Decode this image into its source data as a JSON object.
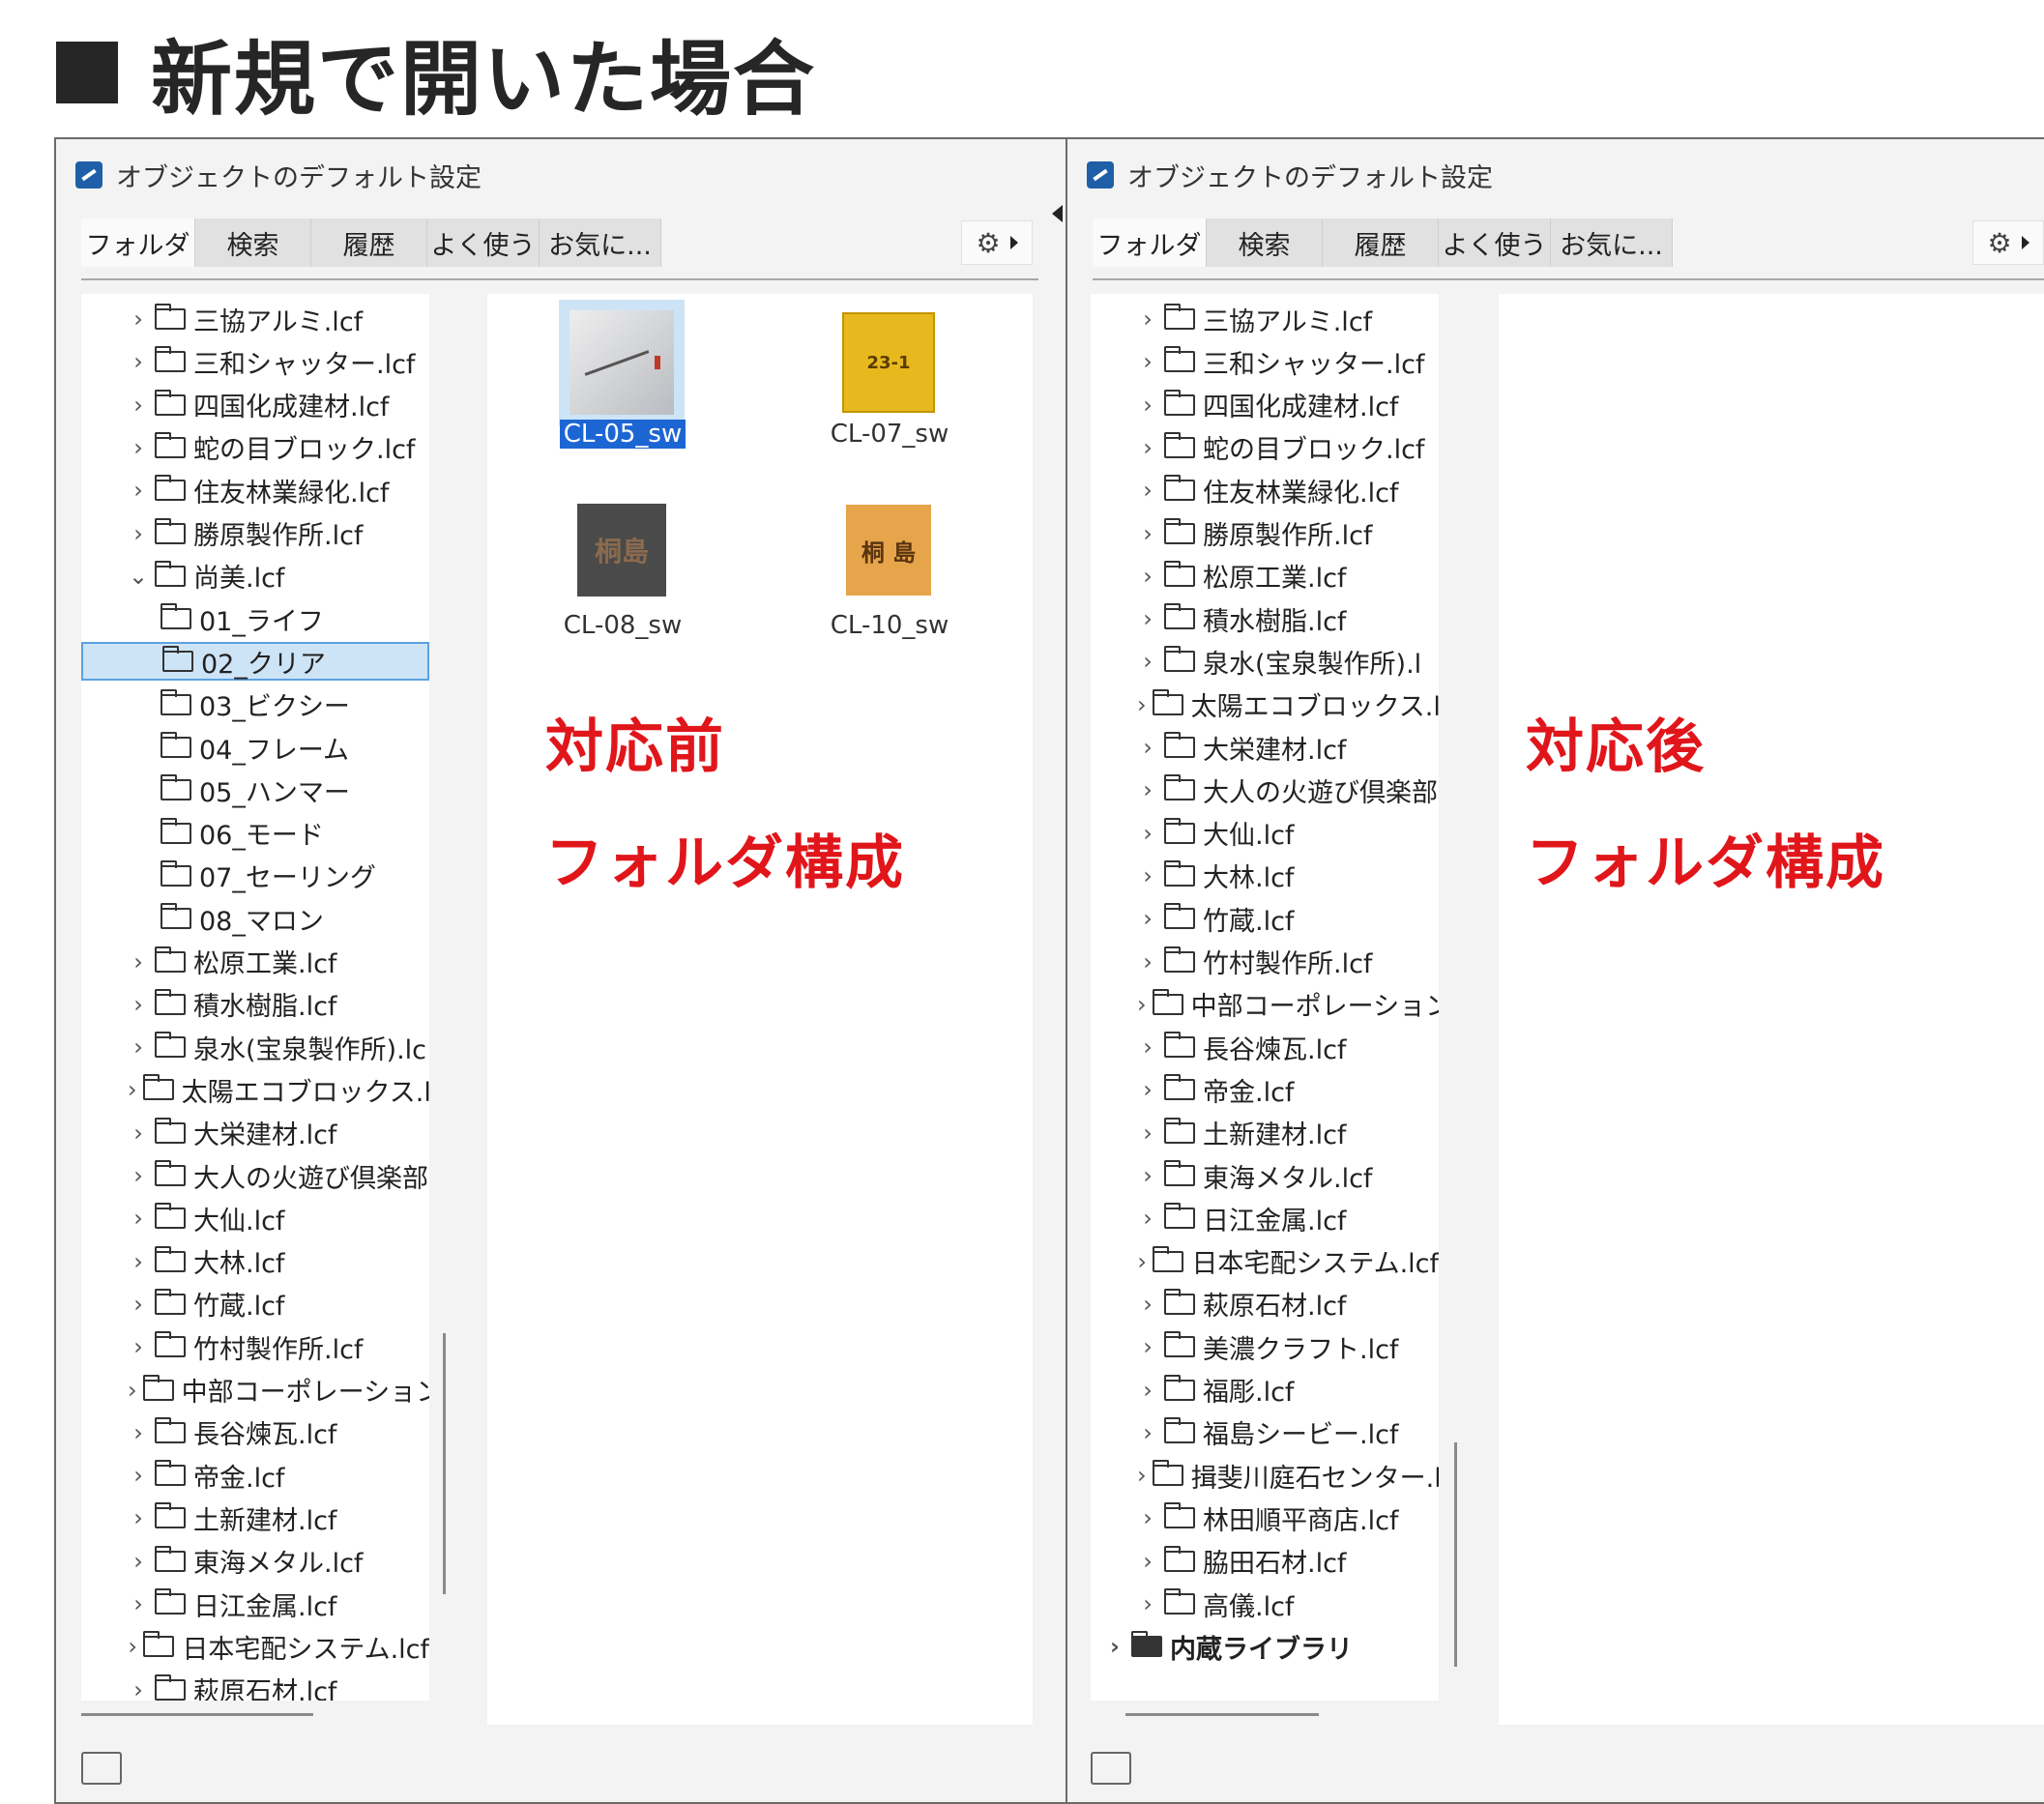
{
  "heading": "新規で開いた場合",
  "colors": {
    "accent_red": "#e0161b",
    "selection_blue": "#1c66d4",
    "selection_bg": "#cde4f7"
  },
  "left": {
    "title": "オブジェクトのデフォルト設定",
    "tabs": [
      "フォルダ",
      "検索",
      "履歴",
      "よく使う",
      "お気に..."
    ],
    "tree": [
      {
        "label": "三協アルミ.lcf",
        "expander": "›"
      },
      {
        "label": "三和シャッター.lcf",
        "expander": "›"
      },
      {
        "label": "四国化成建材.lcf",
        "expander": "›"
      },
      {
        "label": "蛇の目ブロック.lcf",
        "expander": "›"
      },
      {
        "label": "住友林業緑化.lcf",
        "expander": "›"
      },
      {
        "label": "勝原製作所.lcf",
        "expander": "›"
      },
      {
        "label": "尚美.lcf",
        "expander": "⌄"
      },
      {
        "label": "01_ライフ",
        "expander": ""
      },
      {
        "label": "02_クリア",
        "expander": ""
      },
      {
        "label": "03_ビクシー",
        "expander": ""
      },
      {
        "label": "04_フレーム",
        "expander": ""
      },
      {
        "label": "05_ハンマー",
        "expander": ""
      },
      {
        "label": "06_モード",
        "expander": ""
      },
      {
        "label": "07_セーリング",
        "expander": ""
      },
      {
        "label": "08_マロン",
        "expander": ""
      },
      {
        "label": "松原工業.lcf",
        "expander": "›"
      },
      {
        "label": "積水樹脂.lcf",
        "expander": "›"
      },
      {
        "label": "泉水(宝泉製作所).lc",
        "expander": "›"
      },
      {
        "label": "太陽エコブロックス.lcf",
        "expander": "›"
      },
      {
        "label": "大栄建材.lcf",
        "expander": "›"
      },
      {
        "label": "大人の火遊び倶楽部",
        "expander": "›"
      },
      {
        "label": "大仙.lcf",
        "expander": "›"
      },
      {
        "label": "大林.lcf",
        "expander": "›"
      },
      {
        "label": "竹蔵.lcf",
        "expander": "›"
      },
      {
        "label": "竹村製作所.lcf",
        "expander": "›"
      },
      {
        "label": "中部コーポレーション.lcf",
        "expander": "›"
      },
      {
        "label": "長谷煉瓦.lcf",
        "expander": "›"
      },
      {
        "label": "帝金.lcf",
        "expander": "›"
      },
      {
        "label": "土新建材.lcf",
        "expander": "›"
      },
      {
        "label": "東海メタル.lcf",
        "expander": "›"
      },
      {
        "label": "日江金属.lcf",
        "expander": "›"
      },
      {
        "label": "日本宅配システム.lcf",
        "expander": "›"
      },
      {
        "label": "萩原石材.lcf",
        "expander": "›"
      }
    ],
    "thumbnails": [
      {
        "label": "CL-05_sw",
        "plate_text": ""
      },
      {
        "label": "CL-07_sw",
        "plate_text": "23-1"
      },
      {
        "label": "CL-08_sw",
        "plate_text": "桐島"
      },
      {
        "label": "CL-10_sw",
        "plate_text": "桐 島"
      }
    ],
    "annotation_1": "対応前",
    "annotation_2": "フォルダ構成"
  },
  "right": {
    "title": "オブジェクトのデフォルト設定",
    "tabs": [
      "フォルダ",
      "検索",
      "履歴",
      "よく使う",
      "お気に..."
    ],
    "tree": [
      {
        "label": "三協アルミ.lcf"
      },
      {
        "label": "三和シャッター.lcf"
      },
      {
        "label": "四国化成建材.lcf"
      },
      {
        "label": "蛇の目ブロック.lcf"
      },
      {
        "label": "住友林業緑化.lcf"
      },
      {
        "label": "勝原製作所.lcf"
      },
      {
        "label": "松原工業.lcf"
      },
      {
        "label": "積水樹脂.lcf"
      },
      {
        "label": "泉水(宝泉製作所).l"
      },
      {
        "label": "太陽エコブロックス.lcf"
      },
      {
        "label": "大栄建材.lcf"
      },
      {
        "label": "大人の火遊び倶楽部"
      },
      {
        "label": "大仙.lcf"
      },
      {
        "label": "大林.lcf"
      },
      {
        "label": "竹蔵.lcf"
      },
      {
        "label": "竹村製作所.lcf"
      },
      {
        "label": "中部コーポレーション.lcf"
      },
      {
        "label": "長谷煉瓦.lcf"
      },
      {
        "label": "帝金.lcf"
      },
      {
        "label": "土新建材.lcf"
      },
      {
        "label": "東海メタル.lcf"
      },
      {
        "label": "日江金属.lcf"
      },
      {
        "label": "日本宅配システム.lcf"
      },
      {
        "label": "萩原石材.lcf"
      },
      {
        "label": "美濃クラフト.lcf"
      },
      {
        "label": "福彫.lcf"
      },
      {
        "label": "福島シービー.lcf"
      },
      {
        "label": "揖斐川庭石センター.lc"
      },
      {
        "label": "林田順平商店.lcf"
      },
      {
        "label": "脇田石材.lcf"
      },
      {
        "label": "高儀.lcf"
      }
    ],
    "library": "内蔵ライブラリ",
    "annotation_1": "対応後",
    "annotation_2": "フォルダ構成"
  }
}
